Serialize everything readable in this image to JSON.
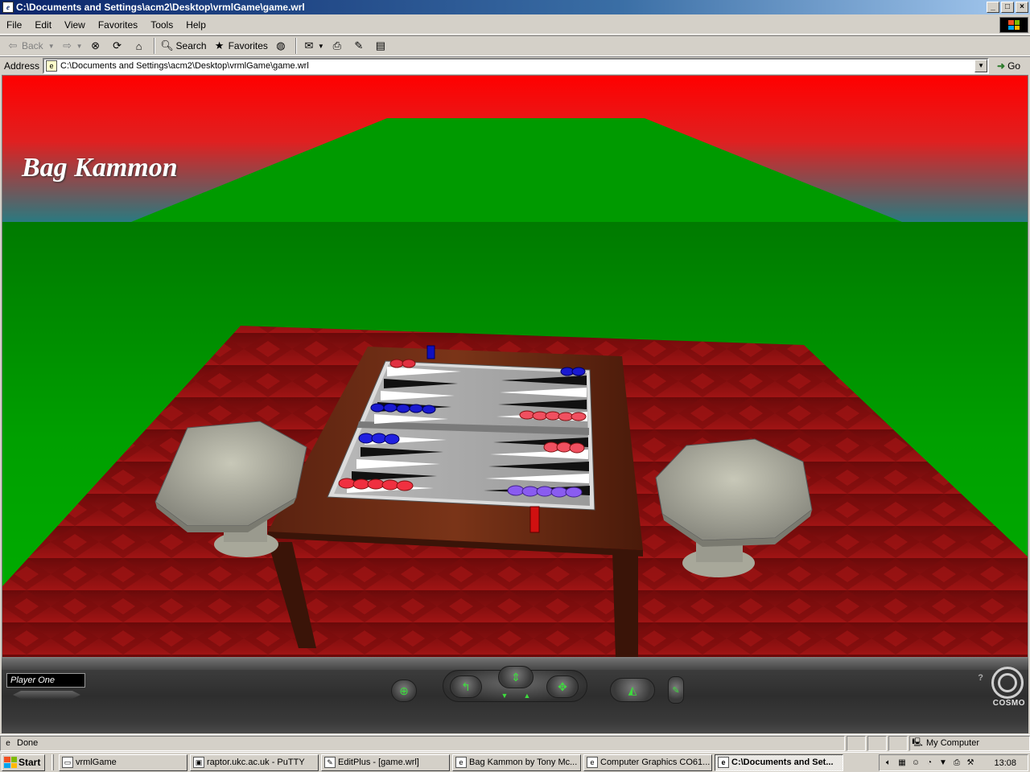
{
  "window": {
    "title": "C:\\Documents and Settings\\acm2\\Desktop\\vrmlGame\\game.wrl",
    "controls": [
      "_",
      "□",
      "×"
    ]
  },
  "menubar": {
    "items": [
      "File",
      "Edit",
      "View",
      "Favorites",
      "Tools",
      "Help"
    ]
  },
  "toolbar": {
    "back": "Back",
    "search": "Search",
    "favorites": "Favorites"
  },
  "address": {
    "label": "Address",
    "value": "C:\\Documents and Settings\\acm2\\Desktop\\vrmlGame\\game.wrl",
    "go": "Go"
  },
  "scene": {
    "title": "Bag Kammon",
    "colors": {
      "sky_top": "#ff0000",
      "horizon": "#2a7a80",
      "ground": "#00a000",
      "carpet": "#8b0f0f",
      "table": "#6b2b14",
      "red_checker": "#e03040",
      "blue_checker": "#1a1ad0",
      "violet_checker": "#8a5cf0"
    }
  },
  "dashboard": {
    "viewpoint": "Player One",
    "help": "?",
    "brand": "COSMO"
  },
  "status": {
    "text": "Done",
    "zone": "My Computer"
  },
  "taskbar": {
    "start": "Start",
    "tasks": [
      {
        "label": "vrmlGame",
        "active": false
      },
      {
        "label": "raptor.ukc.ac.uk - PuTTY",
        "active": false
      },
      {
        "label": "EditPlus - [game.wrl]",
        "active": false
      },
      {
        "label": "Bag Kammon by Tony Mc...",
        "active": false
      },
      {
        "label": "Computer Graphics CO61...",
        "active": false
      },
      {
        "label": "C:\\Documents and Set...",
        "active": true
      }
    ],
    "clock": "13:08"
  }
}
